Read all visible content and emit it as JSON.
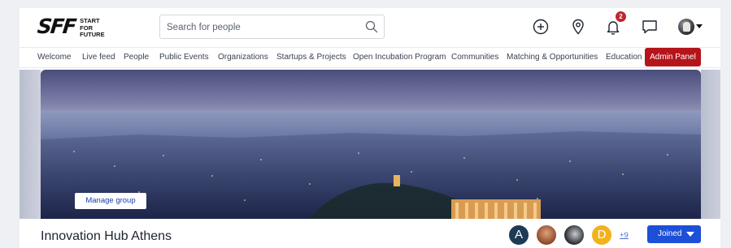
{
  "brand": {
    "mark": "SFF",
    "words": [
      "START",
      "FOR",
      "FUTURE"
    ]
  },
  "search": {
    "placeholder": "Search for people",
    "value": ""
  },
  "header_icons": [
    "add-circle-icon",
    "location-pin-icon",
    "bell-icon",
    "chat-icon"
  ],
  "notifications": {
    "count": "2"
  },
  "nav": {
    "items": [
      "Welcome",
      "Live feed",
      "People",
      "Public Events",
      "Organizations",
      "Startups & Projects",
      "Open Incubation Program",
      "Communities",
      "Matching & Opportunities",
      "Education"
    ],
    "admin_label": "Admin Panel"
  },
  "banner": {
    "manage_label": "Manage group"
  },
  "group": {
    "title": "Innovation Hub Athens",
    "members": [
      {
        "initial": "A",
        "color": "#1d3b56"
      },
      {
        "initial": "",
        "color": "#b0603a"
      },
      {
        "initial": "",
        "color": "#3a3c42"
      },
      {
        "initial": "D",
        "color": "#f2b21b"
      }
    ],
    "more_label": "+9",
    "joined_label": "Joined"
  },
  "colors": {
    "admin": "#b5141b",
    "primary": "#1d4fd8",
    "badge": "#c0262d"
  }
}
